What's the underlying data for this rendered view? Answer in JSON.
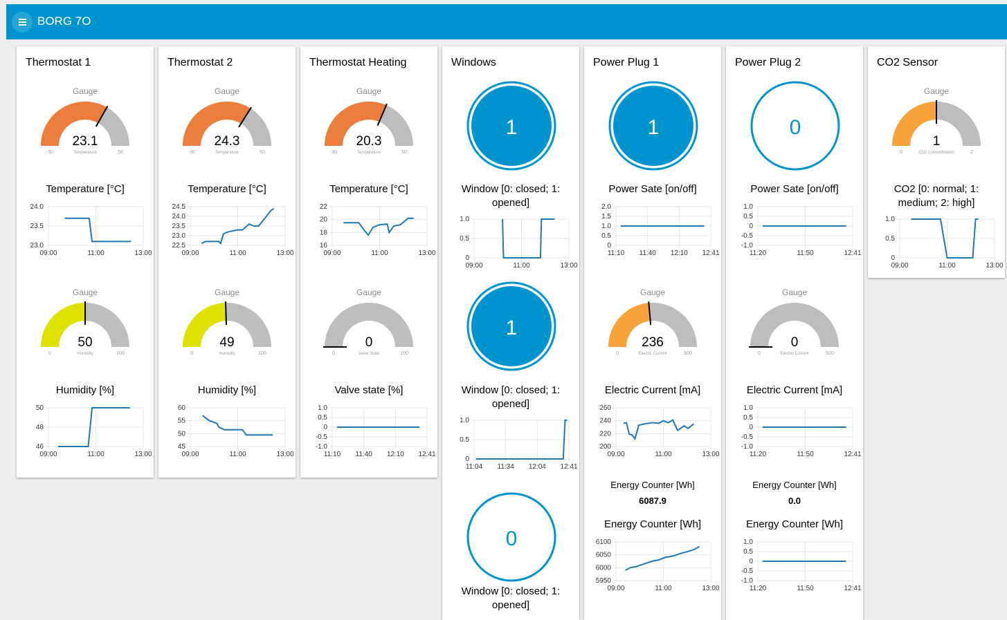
{
  "app": {
    "title": "BORG 7O"
  },
  "colors": {
    "header": "#0094ce",
    "line": "#1f77b4",
    "temp_gauge": "#ed7d3d",
    "humid_gauge": "#dfe100",
    "power_gauge": "#f7a33a",
    "gauge_track": "#bdbdbd",
    "window_fill": "#0094ce"
  },
  "icons": {
    "menu": "hamburger-menu-icon"
  },
  "cards": {
    "thermostat1": {
      "title": "Thermostat 1",
      "gauges": [
        {
          "label": "Gauge",
          "value": 23.1,
          "display": "23.1",
          "min": -30,
          "max": 50,
          "min_label": "-30",
          "max_label": "50",
          "unit_label": "Temperature",
          "color": "#ed7d3d"
        },
        {
          "label": "Gauge",
          "value": 50,
          "display": "50",
          "min": 0,
          "max": 100,
          "min_label": "0",
          "max_label": "100",
          "unit_label": "Humidity",
          "color": "#dfe100"
        }
      ],
      "charts": [
        {
          "title": "Temperature [°C]",
          "yticks": [
            "24.0",
            "23.5",
            "23.0"
          ],
          "ymin": 23.0,
          "ymax": 24.0,
          "yvals": [
            24.0,
            23.5,
            23.0
          ],
          "xticks": [
            "09:00",
            "11:00",
            "13:00"
          ],
          "points": [
            [
              0.17,
              23.7
            ],
            [
              0.43,
              23.7
            ],
            [
              0.46,
              23.1
            ],
            [
              0.87,
              23.1
            ]
          ]
        },
        {
          "title": "Humidity [%]",
          "yticks": [
            "50",
            "48",
            "46"
          ],
          "ymin": 46,
          "ymax": 50,
          "yvals": [
            50,
            48,
            46
          ],
          "xticks": [
            "09:00",
            "11:00",
            "13:00"
          ],
          "points": [
            [
              0.1,
              46
            ],
            [
              0.42,
              46
            ],
            [
              0.46,
              50
            ],
            [
              0.86,
              50
            ]
          ]
        }
      ]
    },
    "thermostat2": {
      "title": "Thermostat 2",
      "gauges": [
        {
          "label": "Gauge",
          "value": 24.3,
          "display": "24.3",
          "min": -30,
          "max": 50,
          "min_label": "-30",
          "max_label": "50",
          "unit_label": "Temperature",
          "color": "#ed7d3d"
        },
        {
          "label": "Gauge",
          "value": 49,
          "display": "49",
          "min": 0,
          "max": 100,
          "min_label": "0",
          "max_label": "100",
          "unit_label": "Humidity",
          "color": "#dfe100"
        }
      ],
      "charts": [
        {
          "title": "Temperature [°C]",
          "yticks": [
            "24.5",
            "24.0",
            "23.5",
            "23.0",
            "22.5"
          ],
          "ymin": 22.5,
          "ymax": 24.5,
          "yvals": [
            24.5,
            24.0,
            23.5,
            23.0,
            22.5
          ],
          "xticks": [
            "09:00",
            "11:00",
            "13:00"
          ],
          "points": [
            [
              0.12,
              22.6
            ],
            [
              0.16,
              22.7
            ],
            [
              0.3,
              22.7
            ],
            [
              0.32,
              22.6
            ],
            [
              0.35,
              23.1
            ],
            [
              0.4,
              23.2
            ],
            [
              0.5,
              23.3
            ],
            [
              0.55,
              23.3
            ],
            [
              0.62,
              23.6
            ],
            [
              0.67,
              23.5
            ],
            [
              0.72,
              23.5
            ],
            [
              0.77,
              23.8
            ],
            [
              0.85,
              24.3
            ],
            [
              0.88,
              24.4
            ]
          ]
        },
        {
          "title": "Humidity [%]",
          "yticks": [
            "60",
            "55",
            "50",
            "45"
          ],
          "ymin": 45,
          "ymax": 60,
          "yvals": [
            60,
            55,
            50,
            45
          ],
          "xticks": [
            "09:00",
            "11:00",
            "13:00"
          ],
          "points": [
            [
              0.13,
              57
            ],
            [
              0.2,
              55
            ],
            [
              0.28,
              54
            ],
            [
              0.3,
              52.5
            ],
            [
              0.36,
              51.5
            ],
            [
              0.45,
              51.5
            ],
            [
              0.55,
              51.5
            ],
            [
              0.59,
              49.5
            ],
            [
              0.87,
              49.5
            ]
          ]
        }
      ]
    },
    "heating": {
      "title": "Thermostat Heating",
      "gauges": [
        {
          "label": "Gauge",
          "value": 20.3,
          "display": "20.3",
          "min": -30,
          "max": 50,
          "min_label": "-30",
          "max_label": "50",
          "unit_label": "Temperature",
          "color": "#ed7d3d"
        },
        {
          "label": "Gauge",
          "value": 0,
          "display": "0",
          "min": 0,
          "max": 100,
          "min_label": "0",
          "max_label": "100",
          "unit_label": "Valve State",
          "color": "#bdbdbd"
        }
      ],
      "charts": [
        {
          "title": "Temperature [°C]",
          "yticks": [
            "22",
            "20",
            "18",
            "16"
          ],
          "ymin": 16,
          "ymax": 22,
          "yvals": [
            22,
            20,
            18,
            16
          ],
          "xticks": [
            "09:00",
            "11:00",
            "13:00"
          ],
          "points": [
            [
              0.12,
              19.5
            ],
            [
              0.28,
              19.5
            ],
            [
              0.33,
              18.5
            ],
            [
              0.38,
              17.6
            ],
            [
              0.43,
              18.8
            ],
            [
              0.5,
              19.2
            ],
            [
              0.58,
              19.3
            ],
            [
              0.6,
              18
            ],
            [
              0.65,
              19
            ],
            [
              0.72,
              19.2
            ],
            [
              0.8,
              20.2
            ],
            [
              0.86,
              20.2
            ]
          ]
        },
        {
          "title": "Valve state [%]",
          "yticks": [
            "1.0",
            "0.5",
            "0",
            "-0.5",
            "-1.0"
          ],
          "ymin": -1,
          "ymax": 1,
          "yvals": [
            1,
            0.5,
            0,
            -0.5,
            -1
          ],
          "xticks": [
            "11:10",
            "11:40",
            "12:10",
            "12:41"
          ],
          "points": [
            [
              0.05,
              0
            ],
            [
              0.92,
              0
            ]
          ]
        }
      ]
    },
    "windows": {
      "title": "Windows",
      "circles": [
        {
          "value": "1",
          "filled": true,
          "caption": "Window [0: closed; 1: opened]"
        },
        {
          "value": "1",
          "filled": true,
          "caption": "Window [0: closed; 1: opened]"
        },
        {
          "value": "0",
          "filled": false,
          "caption": "Window [0: closed; 1: opened]"
        }
      ],
      "charts": [
        {
          "yticks": [
            "1.0",
            "0.5",
            "0"
          ],
          "ymin": 0,
          "ymax": 1,
          "yvals": [
            1,
            0.5,
            0
          ],
          "xticks": [
            "09:00",
            "11:00",
            "13:00"
          ],
          "points": [
            [
              0.3,
              1
            ],
            [
              0.31,
              0
            ],
            [
              0.7,
              0
            ],
            [
              0.71,
              1
            ],
            [
              0.85,
              1
            ]
          ]
        },
        {
          "yticks": [
            "1.0",
            "0.5",
            "0"
          ],
          "ymin": 0,
          "ymax": 1,
          "yvals": [
            1,
            0.5,
            0
          ],
          "xticks": [
            "11:04",
            "11:34",
            "12:04",
            "12:41"
          ],
          "points": [
            [
              0.02,
              0
            ],
            [
              0.94,
              0
            ],
            [
              0.96,
              1
            ],
            [
              0.98,
              1
            ]
          ]
        }
      ]
    },
    "plug1": {
      "title": "Power Plug 1",
      "circle": {
        "value": "1",
        "filled": true
      },
      "gauge": {
        "label": "Gauge",
        "value": 236,
        "display": "236",
        "min": 0,
        "max": 500,
        "min_label": "0",
        "max_label": "500",
        "unit_label": "Electric Current",
        "color": "#f7a33a"
      },
      "energy": {
        "title": "Energy Counter [Wh]",
        "value": "6087.9"
      },
      "charts": [
        {
          "title": "Power Sate [on/off]",
          "yticks": [
            "2.0",
            "1.5",
            "1.0",
            "0.5",
            "0"
          ],
          "ymin": 0,
          "ymax": 2,
          "yvals": [
            2,
            1.5,
            1,
            0.5,
            0
          ],
          "xticks": [
            "11:10",
            "11:40",
            "12:10",
            "12:41"
          ],
          "points": [
            [
              0.05,
              1
            ],
            [
              0.93,
              1
            ]
          ]
        },
        {
          "title": "Electric Current [mA]",
          "yticks": [
            "260",
            "240",
            "220",
            "200"
          ],
          "ymin": 200,
          "ymax": 260,
          "yvals": [
            260,
            240,
            220,
            200
          ],
          "xticks": [
            "09:00",
            "11:00",
            "13:00"
          ],
          "points": [
            [
              0.08,
              236
            ],
            [
              0.11,
              237
            ],
            [
              0.14,
              219
            ],
            [
              0.17,
              218
            ],
            [
              0.2,
              212
            ],
            [
              0.24,
              233
            ],
            [
              0.3,
              235
            ],
            [
              0.38,
              237
            ],
            [
              0.45,
              236
            ],
            [
              0.5,
              240
            ],
            [
              0.55,
              237
            ],
            [
              0.6,
              241
            ],
            [
              0.65,
              225
            ],
            [
              0.72,
              232
            ],
            [
              0.76,
              228
            ],
            [
              0.82,
              235
            ]
          ]
        },
        {
          "title": "Energy Counter [Wh]",
          "yticks": [
            "6100",
            "6050",
            "6000",
            "5950"
          ],
          "ymin": 5950,
          "ymax": 6100,
          "yvals": [
            6100,
            6050,
            6000,
            5950
          ],
          "xticks": [
            "09:00",
            "11:00",
            "13:00"
          ],
          "points": [
            [
              0.1,
              5990
            ],
            [
              0.15,
              6000
            ],
            [
              0.22,
              6005
            ],
            [
              0.3,
              6015
            ],
            [
              0.38,
              6025
            ],
            [
              0.45,
              6030
            ],
            [
              0.52,
              6040
            ],
            [
              0.6,
              6045
            ],
            [
              0.68,
              6055
            ],
            [
              0.75,
              6062
            ],
            [
              0.82,
              6070
            ],
            [
              0.88,
              6082
            ]
          ]
        }
      ]
    },
    "plug2": {
      "title": "Power Plug 2",
      "circle": {
        "value": "0",
        "filled": false
      },
      "gauge": {
        "label": "Gauge",
        "value": 0,
        "display": "0",
        "min": 0,
        "max": 500,
        "min_label": "0",
        "max_label": "500",
        "unit_label": "Electric Current",
        "color": "#bdbdbd"
      },
      "energy": {
        "title": "Energy Counter [Wh]",
        "value": "0.0"
      },
      "charts": [
        {
          "title": "Power Sate [on/off]",
          "yticks": [
            "1.0",
            "0.5",
            "0",
            "-0.5",
            "-1.0"
          ],
          "ymin": -1,
          "ymax": 1,
          "yvals": [
            1,
            0.5,
            0,
            -0.5,
            -1
          ],
          "xticks": [
            "11:20",
            "11:50",
            "12:41"
          ],
          "points": [
            [
              0.05,
              0
            ],
            [
              0.93,
              0
            ]
          ]
        },
        {
          "title": "Electric Current [mA]",
          "yticks": [
            "1.0",
            "0.5",
            "0",
            "-0.5",
            "-1.0"
          ],
          "ymin": -1,
          "ymax": 1,
          "yvals": [
            1,
            0.5,
            0,
            -0.5,
            -1
          ],
          "xticks": [
            "11:20",
            "11:50",
            "12:41"
          ],
          "points": [
            [
              0.05,
              0
            ],
            [
              0.93,
              0
            ]
          ]
        },
        {
          "title": "Energy Counter [Wh]",
          "yticks": [
            "1.0",
            "0.5",
            "0",
            "-0.5",
            "-1.0"
          ],
          "ymin": -1,
          "ymax": 1,
          "yvals": [
            1,
            0.5,
            0,
            -0.5,
            -1
          ],
          "xticks": [
            "11:20",
            "11:50",
            "12:41"
          ],
          "points": [
            [
              0.05,
              0
            ],
            [
              0.93,
              0
            ]
          ]
        }
      ]
    },
    "co2": {
      "title": "CO2 Sensor",
      "gauge": {
        "label": "Gauge",
        "value": 1,
        "display": "1",
        "min": 0,
        "max": 2,
        "min_label": "0",
        "max_label": "2",
        "unit_label": "CO2 Concentration",
        "color": "#f7a33a"
      },
      "chart": {
        "title": "CO2 [0: normal; 1: medium; 2: high]",
        "yticks": [
          "1.0",
          "0.5",
          "0"
        ],
        "ymin": 0,
        "ymax": 1,
        "yvals": [
          1,
          0.5,
          0
        ],
        "xticks": [
          "09:00",
          "11:00",
          "13:00"
        ],
        "points": [
          [
            0.12,
            1
          ],
          [
            0.43,
            1
          ],
          [
            0.5,
            0
          ],
          [
            0.77,
            0
          ],
          [
            0.8,
            1
          ],
          [
            0.83,
            1
          ]
        ]
      }
    }
  }
}
